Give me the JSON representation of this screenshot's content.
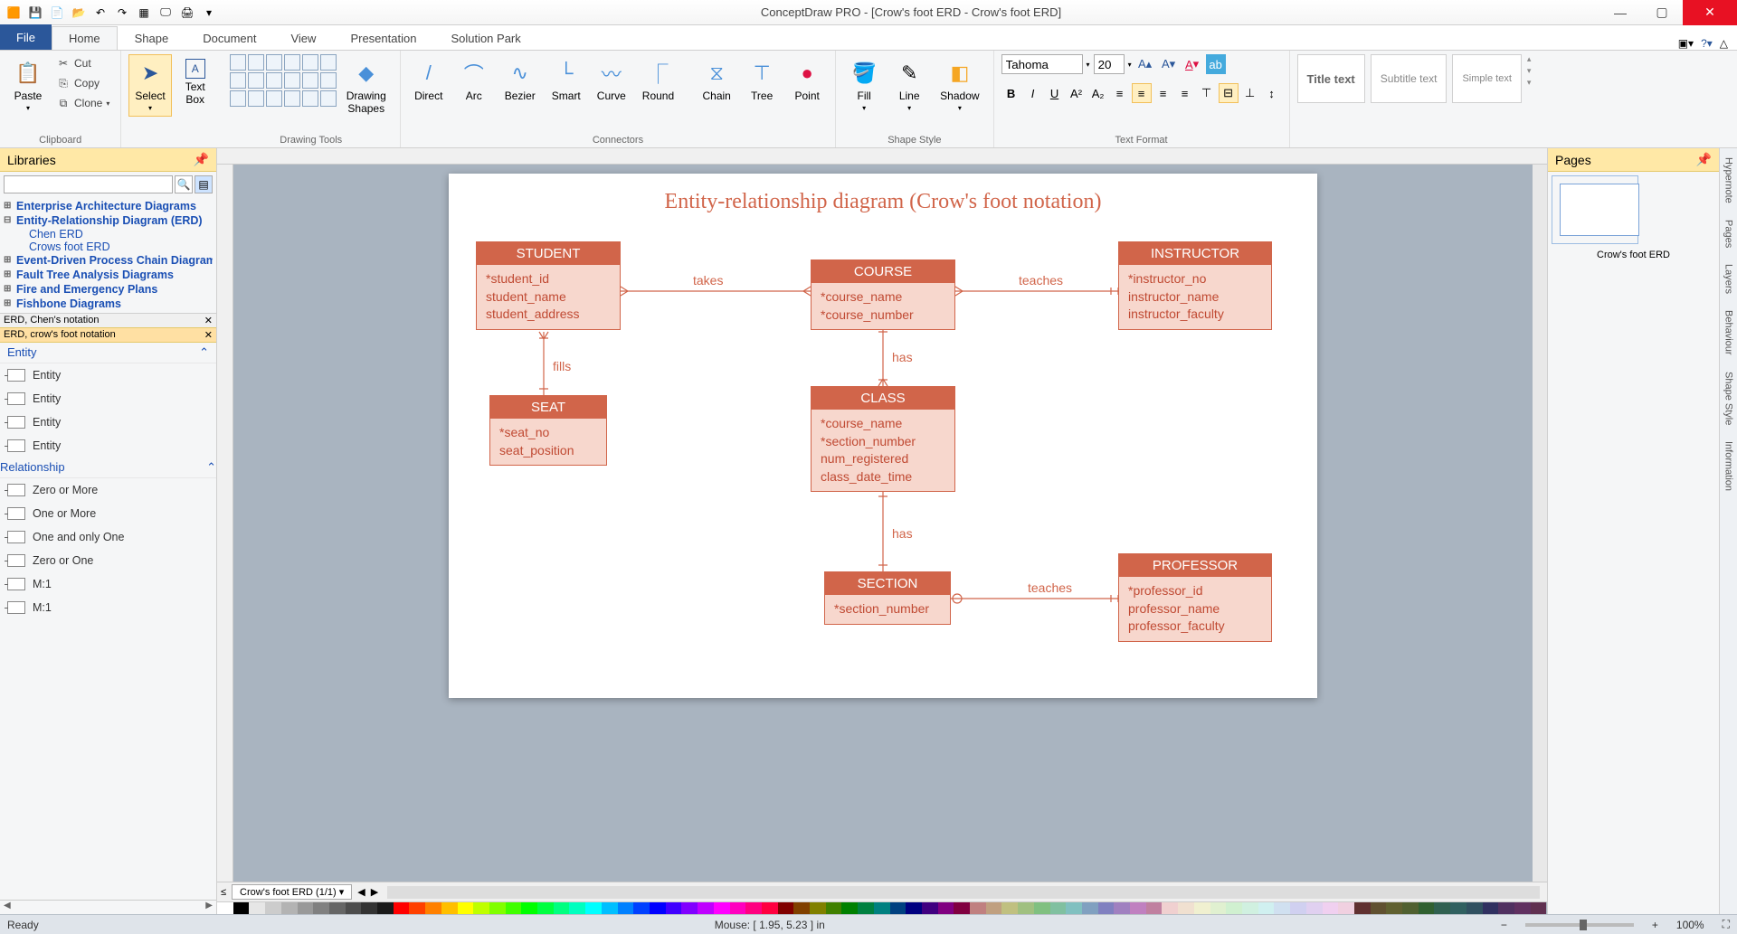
{
  "app": {
    "title": "ConceptDraw PRO - [Crow's foot ERD - Crow's foot ERD]"
  },
  "tabs": {
    "file": "File",
    "items": [
      "Home",
      "Shape",
      "Document",
      "View",
      "Presentation",
      "Solution Park"
    ],
    "active": "Home"
  },
  "ribbon": {
    "clipboard": {
      "paste": "Paste",
      "cut": "Cut",
      "copy": "Copy",
      "clone": "Clone",
      "label": "Clipboard"
    },
    "select_btn": "Select",
    "textbox_btn": "Text\nBox",
    "drawing_shapes": "Drawing\nShapes",
    "drawing_tools_label": "Drawing Tools",
    "connectors": {
      "direct": "Direct",
      "arc": "Arc",
      "bezier": "Bezier",
      "smart": "Smart",
      "curve": "Curve",
      "round": "Round",
      "chain": "Chain",
      "tree": "Tree",
      "point": "Point",
      "label": "Connectors"
    },
    "shapestyle": {
      "fill": "Fill",
      "line": "Line",
      "shadow": "Shadow",
      "label": "Shape Style"
    },
    "font": {
      "name": "Tahoma",
      "size": "20"
    },
    "textformat_label": "Text Format",
    "presets": {
      "title": "Title text",
      "subtitle": "Subtitle text",
      "simple": "Simple text"
    }
  },
  "libraries": {
    "header": "Libraries",
    "tree": [
      {
        "label": "Enterprise Architecture Diagrams",
        "bold": true
      },
      {
        "label": "Entity-Relationship Diagram (ERD)",
        "bold": true,
        "open": true,
        "children": [
          "Chen ERD",
          "Crows foot ERD"
        ]
      },
      {
        "label": "Event-Driven Process Chain Diagrams",
        "bold": true
      },
      {
        "label": "Fault Tree Analysis Diagrams",
        "bold": true
      },
      {
        "label": "Fire and Emergency Plans",
        "bold": true
      },
      {
        "label": "Fishbone Diagrams",
        "bold": true
      }
    ],
    "notations": [
      "ERD, Chen's notation",
      "ERD, crow's foot notation"
    ],
    "categories": {
      "entity": {
        "label": "Entity",
        "items": [
          "Entity",
          "Entity",
          "Entity",
          "Entity"
        ]
      },
      "relationship": {
        "label": "Relationship",
        "items": [
          "Zero or More",
          "One or More",
          "One and only One",
          "Zero or One",
          "M:1",
          "M:1"
        ]
      }
    }
  },
  "diagram": {
    "title": "Entity-relationship diagram (Crow's foot notation)",
    "entities": {
      "student": {
        "title": "STUDENT",
        "attrs": [
          "*student_id",
          "student_name",
          "student_address"
        ]
      },
      "course": {
        "title": "COURSE",
        "attrs": [
          "*course_name",
          "*course_number"
        ]
      },
      "instructor": {
        "title": "INSTRUCTOR",
        "attrs": [
          "*instructor_no",
          "instructor_name",
          "instructor_faculty"
        ]
      },
      "seat": {
        "title": "SEAT",
        "attrs": [
          "*seat_no",
          "seat_position"
        ]
      },
      "class": {
        "title": "CLASS",
        "attrs": [
          "*course_name",
          "*section_number",
          "num_registered",
          "class_date_time"
        ]
      },
      "section": {
        "title": "SECTION",
        "attrs": [
          "*section_number"
        ]
      },
      "professor": {
        "title": "PROFESSOR",
        "attrs": [
          "*professor_id",
          "professor_name",
          "professor_faculty"
        ]
      }
    },
    "relations": {
      "takes": "takes",
      "teaches": "teaches",
      "fills": "fills",
      "has": "has",
      "has2": "has",
      "teaches2": "teaches"
    }
  },
  "pages": {
    "header": "Pages",
    "thumb_label": "Crow's foot ERD",
    "tab": "Crow's foot ERD (1/1)"
  },
  "side_tabs": [
    "Hypernote",
    "Pages",
    "Layers",
    "Behaviour",
    "Shape Style",
    "Information"
  ],
  "status": {
    "ready": "Ready",
    "mouse": "Mouse: [ 1.95, 5.23 ] in",
    "zoom": "100%"
  },
  "colors": [
    "#ffffff",
    "#000000",
    "#e6e6e6",
    "#cccccc",
    "#b3b3b3",
    "#999999",
    "#808080",
    "#666666",
    "#4d4d4d",
    "#333333",
    "#1a1a1a",
    "#ff0000",
    "#ff4000",
    "#ff8000",
    "#ffbf00",
    "#ffff00",
    "#bfff00",
    "#80ff00",
    "#40ff00",
    "#00ff00",
    "#00ff40",
    "#00ff80",
    "#00ffbf",
    "#00ffff",
    "#00bfff",
    "#0080ff",
    "#0040ff",
    "#0000ff",
    "#4000ff",
    "#8000ff",
    "#bf00ff",
    "#ff00ff",
    "#ff00bf",
    "#ff0080",
    "#ff0040",
    "#800000",
    "#804000",
    "#808000",
    "#408000",
    "#008000",
    "#008040",
    "#008080",
    "#004080",
    "#000080",
    "#400080",
    "#800080",
    "#800040",
    "#c08080",
    "#c0a080",
    "#c0c080",
    "#a0c080",
    "#80c080",
    "#80c0a0",
    "#80c0c0",
    "#80a0c0",
    "#8080c0",
    "#a080c0",
    "#c080c0",
    "#c080a0",
    "#f0d0d0",
    "#f0e0d0",
    "#f0f0d0",
    "#e0f0d0",
    "#d0f0d0",
    "#d0f0e0",
    "#d0f0f0",
    "#d0e0f0",
    "#d0d0f0",
    "#e0d0f0",
    "#f0d0f0",
    "#f0d0e0",
    "#603030",
    "#605030",
    "#606030",
    "#506030",
    "#306030",
    "#306050",
    "#306060",
    "#305060",
    "#303060",
    "#503060",
    "#603060",
    "#603050"
  ]
}
